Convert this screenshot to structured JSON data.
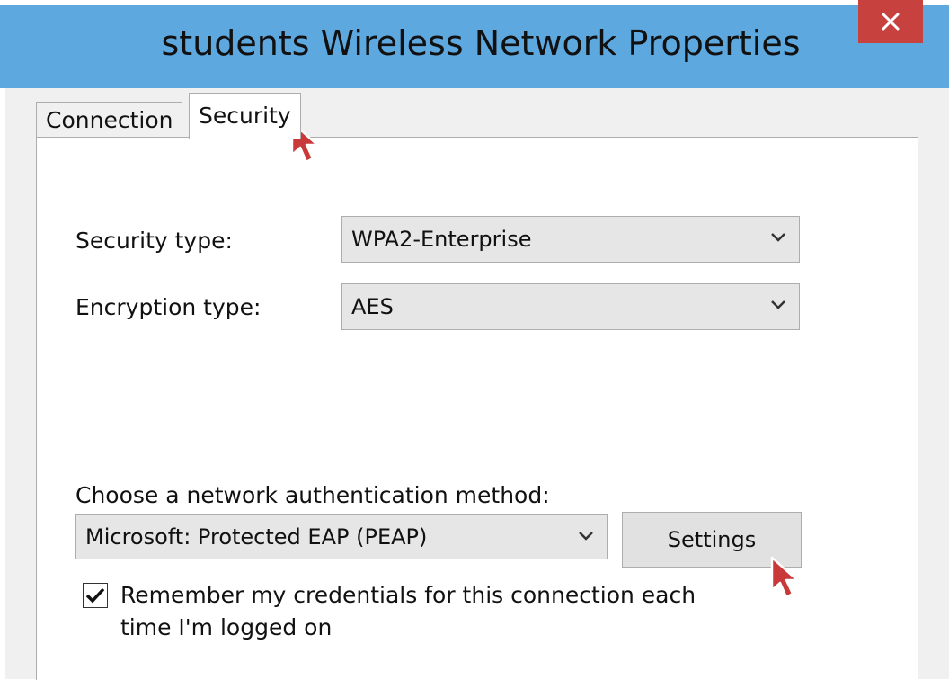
{
  "window": {
    "title": "students Wireless Network Properties",
    "close_icon": "close-icon",
    "accent_color": "#5ea8e0",
    "close_color": "#c7413f"
  },
  "tabs": [
    {
      "label": "Connection",
      "selected": false
    },
    {
      "label": "Security",
      "selected": true
    }
  ],
  "security": {
    "security_type_label": "Security type:",
    "security_type_value": "WPA2-Enterprise",
    "encryption_type_label": "Encryption type:",
    "encryption_type_value": "AES",
    "auth_method_label": "Choose a network authentication method:",
    "auth_method_value": "Microsoft: Protected EAP (PEAP)",
    "settings_button": "Settings",
    "remember_checkbox_label": "Remember my credentials for this connection each time I'm logged on",
    "remember_checked": true
  }
}
